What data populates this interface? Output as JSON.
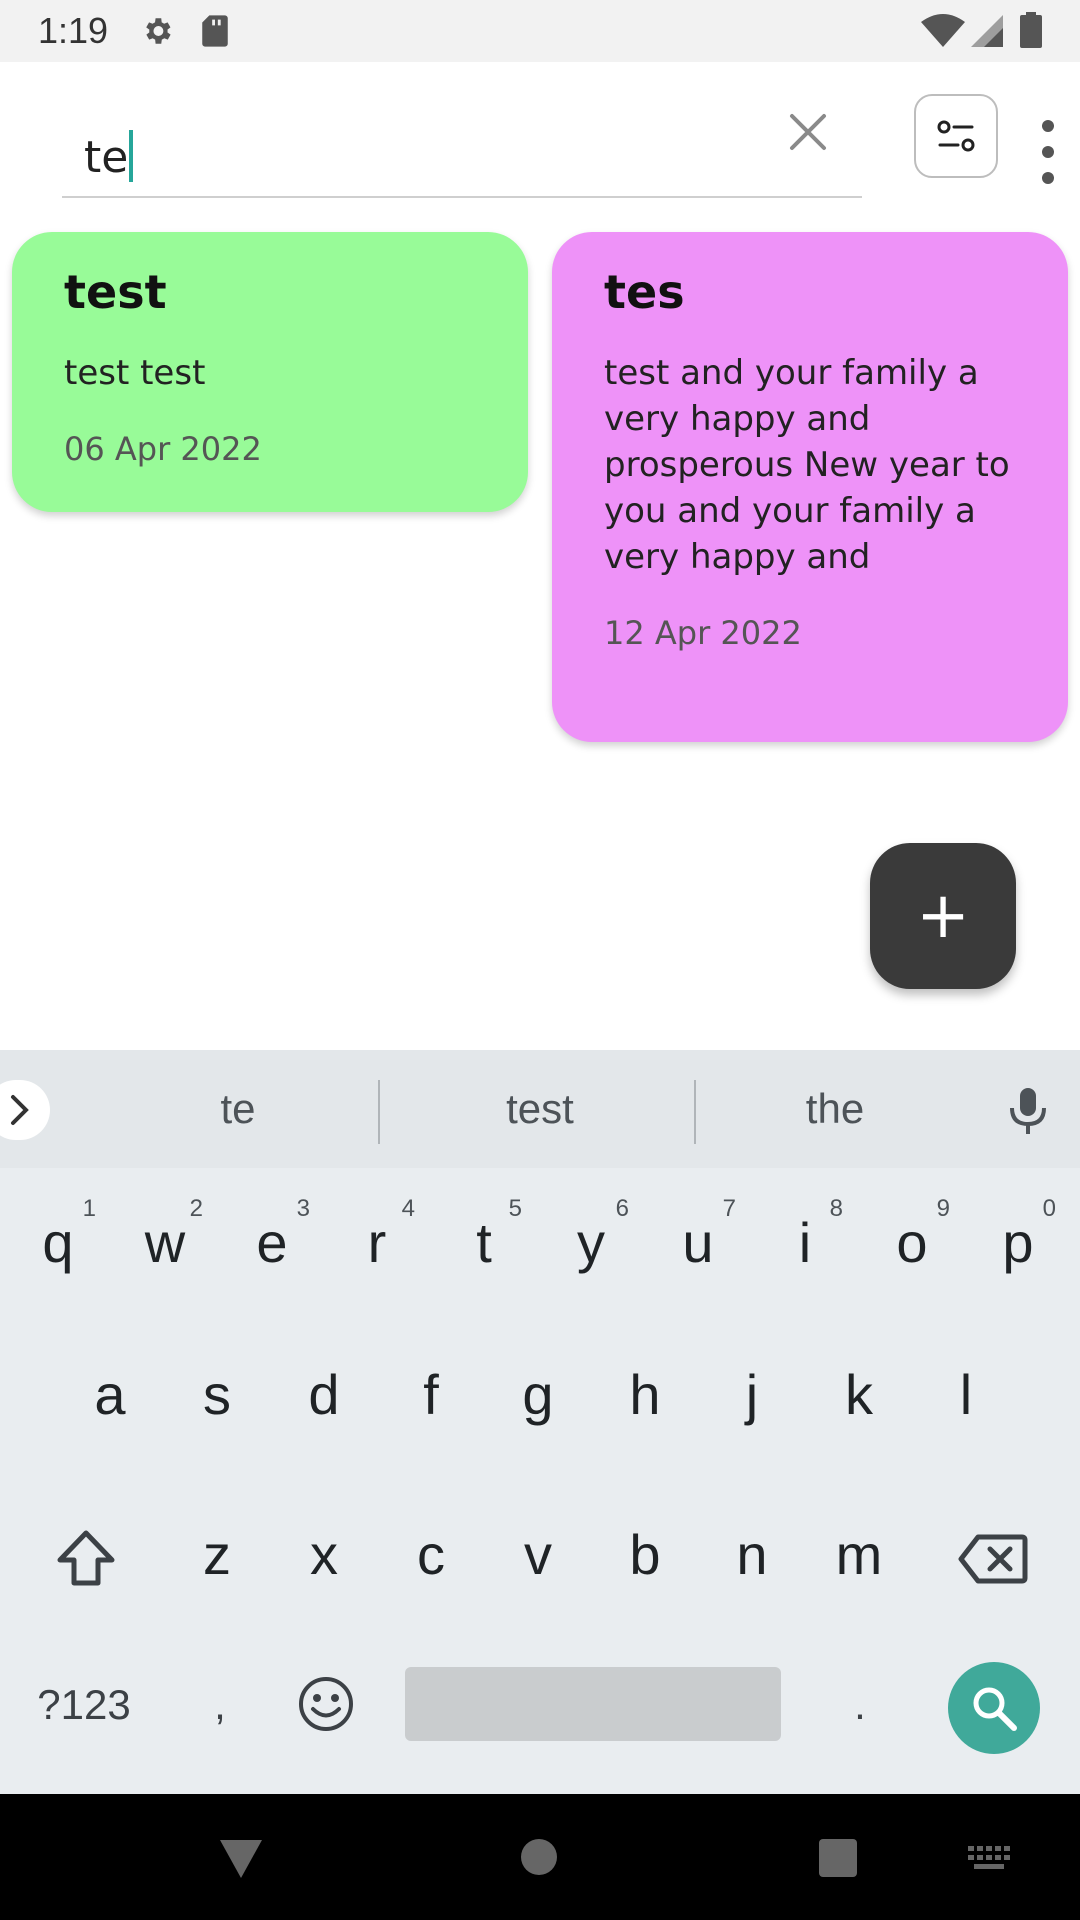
{
  "status_bar": {
    "time": "1:19",
    "icons": [
      "gear-icon",
      "sd-card-icon",
      "wifi-icon",
      "signal-icon",
      "battery-icon"
    ]
  },
  "search": {
    "value": "te",
    "clear_icon": "close-icon",
    "filter_icon": "filter-toggle-icon",
    "more_icon": "more-vert-icon"
  },
  "notes": [
    {
      "title": "test",
      "body": "test test",
      "date": "06 Apr 2022",
      "color": "#98fb98"
    },
    {
      "title": "tes",
      "body": "test and your family a very happy and prosperous New year to you and your family a very happy and",
      "date": "12 Apr 2022",
      "color": "#ee92f8"
    }
  ],
  "fab": {
    "label": "+",
    "icon": "add-icon"
  },
  "keyboard": {
    "suggestions": [
      "te",
      "test",
      "the"
    ],
    "row1": [
      {
        "key": "q",
        "hint": "1"
      },
      {
        "key": "w",
        "hint": "2"
      },
      {
        "key": "e",
        "hint": "3"
      },
      {
        "key": "r",
        "hint": "4"
      },
      {
        "key": "t",
        "hint": "5"
      },
      {
        "key": "y",
        "hint": "6"
      },
      {
        "key": "u",
        "hint": "7"
      },
      {
        "key": "i",
        "hint": "8"
      },
      {
        "key": "o",
        "hint": "9"
      },
      {
        "key": "p",
        "hint": "0"
      }
    ],
    "row2": [
      "a",
      "s",
      "d",
      "f",
      "g",
      "h",
      "j",
      "k",
      "l"
    ],
    "row3": [
      "z",
      "x",
      "c",
      "v",
      "b",
      "n",
      "m"
    ],
    "symbols_label": "?123",
    "comma_label": ",",
    "period_label": ".",
    "accent_color": "#40a99a"
  },
  "nav_bar": {
    "icons": [
      "back-icon",
      "home-icon",
      "recents-icon",
      "keyboard-switch-icon"
    ]
  }
}
